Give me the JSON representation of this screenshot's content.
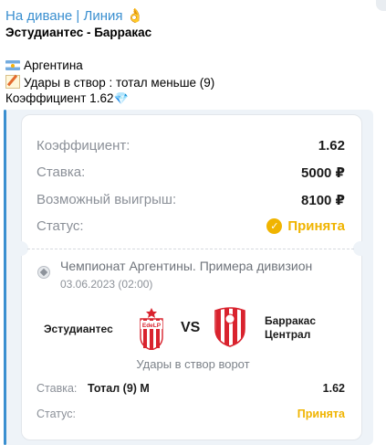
{
  "message": {
    "channel_title": "На диване | Линия",
    "channel_emoji": "👌",
    "match_title": "Эстудиантес - Барракас",
    "country": "Аргентина",
    "bet_line": "Удары в створ : тотал меньше (9)",
    "odds_line": "Коэффициент 1.62",
    "odds_emoji": "💎"
  },
  "card": {
    "rows": [
      {
        "label": "Коэффициент:",
        "value": "1.62"
      },
      {
        "label": "Ставка:",
        "value": "5000 ₽"
      },
      {
        "label": "Возможный выигрыш:",
        "value": "8100 ₽"
      }
    ],
    "status_label": "Статус:",
    "status_value": "Принята",
    "status_icon": "check-icon",
    "league": "Чемпионат Аргентины. Примера дивизион",
    "date": "03.06.2023 (02:00)",
    "home_team": "Эстудиантес",
    "away_team": "Барракас Централ",
    "vs": "VS",
    "home_logo_text": "EdeLP",
    "market": "Удары в створ ворот",
    "footer": {
      "bet_label": "Ставка:",
      "bet_value": "Тотал (9) М",
      "odds": "1.62",
      "status_label": "Статус:",
      "status_value": "Принята"
    }
  },
  "colors": {
    "accent": "#3a8fd0",
    "status": "#f0b400",
    "label": "#8b9098"
  }
}
